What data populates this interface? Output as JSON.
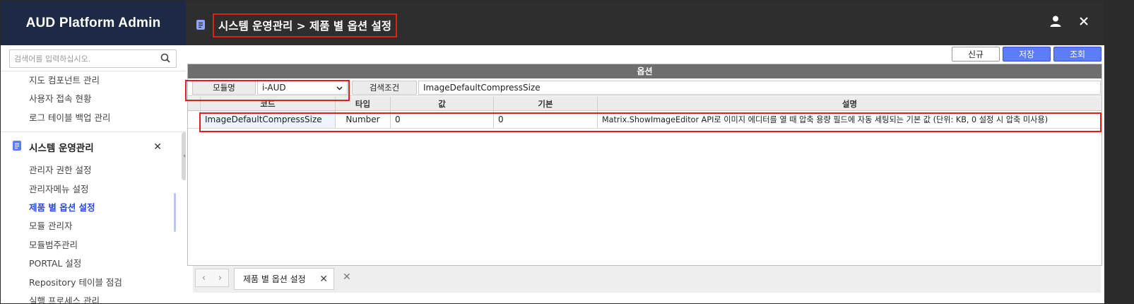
{
  "app": {
    "brand": "AUD Platform Admin",
    "breadcrumb": "시스템 운영관리 > 제품 별 옵션 설정"
  },
  "sidebar": {
    "search_placeholder": "검색어를 입력하십시오.",
    "items_top": [
      {
        "label": "지도 컴포넌트 관리"
      },
      {
        "label": "사용자 접속 현황"
      },
      {
        "label": "로그 테이블 백업 관리"
      }
    ],
    "section": {
      "label": "시스템 운영관리"
    },
    "items": [
      {
        "label": "관리자 권한 설정"
      },
      {
        "label": "관리자메뉴 설정"
      },
      {
        "label": "제품 별 옵션 설정",
        "active": true
      },
      {
        "label": "모듈 관리자"
      },
      {
        "label": "모듈범주관리"
      },
      {
        "label": "PORTAL 설정"
      },
      {
        "label": "Repository 테이블 점검"
      },
      {
        "label": "실행 프로세스 관리"
      }
    ]
  },
  "toolbar": {
    "new_label": "신규",
    "save_label": "저장",
    "query_label": "조회"
  },
  "panel": {
    "title": "옵션",
    "module_label": "모듈명",
    "module_value": "i-AUD",
    "search_label": "검색조건",
    "search_value": "ImageDefaultCompressSize"
  },
  "grid": {
    "columns": [
      "코드",
      "타입",
      "값",
      "기본",
      "설명"
    ],
    "rows": [
      {
        "code": "ImageDefaultCompressSize",
        "type": "Number",
        "value": "0",
        "default": "0",
        "desc": "Matrix.ShowImageEditor API로 이미지 에디터를 열 때 압축 용량 필드에 자동 세팅되는 기본 값 (단위: KB, 0 설정 시 압축 미사용)"
      }
    ]
  },
  "tabs": [
    {
      "label": "제품 별 옵션 설정"
    }
  ],
  "colors": {
    "brand_bg": "#1e2a45",
    "accent": "#5c7cfa",
    "highlight": "#e01f1f",
    "active_text": "#2a4bd7"
  }
}
